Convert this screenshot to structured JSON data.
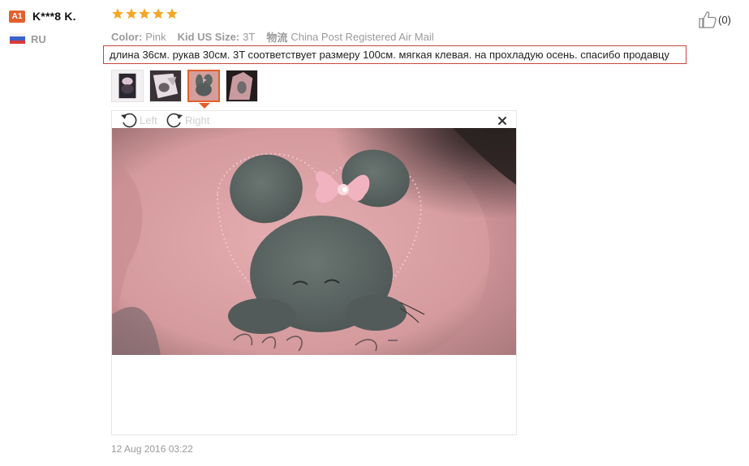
{
  "reviewer": {
    "level_badge": "A1",
    "name": "K***8 K.",
    "country_code": "RU",
    "flag_colors": [
      "#f2f2f2",
      "#3a62c8",
      "#d93b3b"
    ]
  },
  "rating": {
    "stars": 5,
    "max": 5,
    "star_color": "#f5a623"
  },
  "attributes": [
    {
      "label": "Color:",
      "value": "Pink"
    },
    {
      "label": "Kid US Size:",
      "value": "3T"
    },
    {
      "label": "物流",
      "value": "China Post Registered Air Mail"
    }
  ],
  "review_text": "длина 36см. рукав 30см. 3T соответствует размеру 100см. мягкая клевая. на прохладую осень. спасибо продавцу",
  "helpful": {
    "count_label": "(0)",
    "icon": "thumbs-up-icon"
  },
  "thumbnails": [
    {
      "name": "thumb-1",
      "active": false
    },
    {
      "name": "thumb-2",
      "active": false
    },
    {
      "name": "thumb-3",
      "active": true
    },
    {
      "name": "thumb-4",
      "active": false
    }
  ],
  "viewer": {
    "rotate_left_label": "Left",
    "rotate_right_label": "Right",
    "close_icon": "close-icon"
  },
  "date": "12 Aug 2016 03:22",
  "colors": {
    "accent": "#e3602c",
    "review_border": "#c9463d",
    "muted_text": "#9a9a9a"
  }
}
